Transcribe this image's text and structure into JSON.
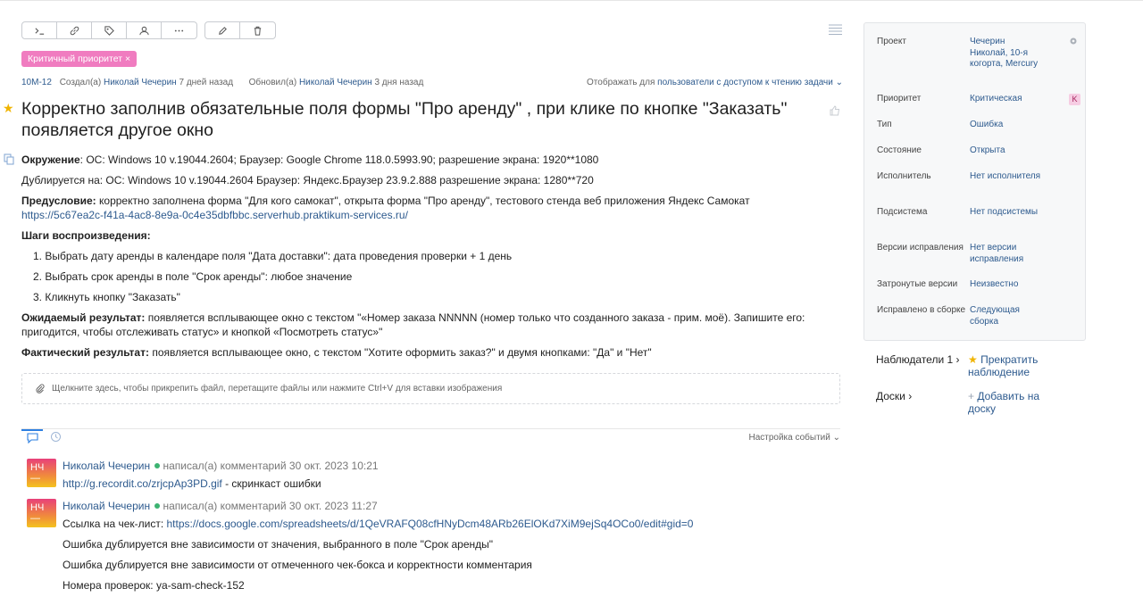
{
  "toolbar": {
    "buttons": [
      {
        "icon": "terminal-icon"
      },
      {
        "icon": "link-icon"
      },
      {
        "icon": "tag-icon"
      },
      {
        "icon": "user-icon"
      },
      {
        "icon": "more-icon"
      },
      {
        "icon": "edit-icon"
      },
      {
        "icon": "trash-icon"
      }
    ]
  },
  "issue": {
    "tag": "Критичный приоритет ×",
    "key": "10M-12",
    "created_prefix": "Создал(а)",
    "author": "Николай Чечерин",
    "created_ago": "7 дней назад",
    "updated_prefix": "Обновил(а)",
    "updater": "Николай Чечерин",
    "updated_ago": "3 дня назад",
    "visibility_prefix": "Отображать для",
    "visibility_link": "пользователи с доступом к чтению задачи",
    "title": "Корректно заполнив обязательные поля формы \"Про аренду\" , при клике по кнопке \"Заказать\" появляется другое окно"
  },
  "description": {
    "env_label": "Окружение",
    "env_text": ": ОС: Windows 10 v.19044.2604; Браузер: Google Chrome 118.0.5993.90; разрешение экрана: 1920**1080",
    "dup_text": "Дублируется на: ОС: Windows 10 v.19044.2604 Браузер: Яндекс.Браузер 23.9.2.888 разрешение экрана: 1280**720",
    "pre_label": "Предусловие:",
    "pre_text": " корректно заполнена форма \"Для кого самокат\", открыта форма \"Про аренду\", тестового стенда веб приложения Яндекс Самокат",
    "pre_link": "https://5c67ea2c-f41a-4ac8-8e9a-0c4e35dbfbbc.serverhub.praktikum-services.ru/",
    "steps_label": "Шаги воспроизведения:",
    "steps": [
      "1. Выбрать дату аренды в календаре поля \"Дата доставки\": дата проведения проверки + 1 день",
      "2. Выбрать срок аренды в поле \"Срок аренды\": любое значение",
      "3. Кликнуть кнопку \"Заказать\""
    ],
    "expected_label": "Ожидаемый результат:",
    "expected_text": " появляется всплывающее окно с текстом \"«Номер заказа NNNNN (номер только что созданного заказа - прим. моё). Запишите его: пригодится, чтобы отслеживать статус» и кнопкой «Посмотреть статус»\"",
    "actual_label": "Фактический результат:",
    "actual_text": " появляется всплывающее окно, с текстом \"Хотите оформить заказ?\" и двумя кнопками: \"Да\" и \"Нет\""
  },
  "attach": {
    "text": "Щелкните здесь, чтобы прикрепить файл, перетащите файлы или нажмите Ctrl+V для вставки изображения"
  },
  "activity": {
    "events_setting": "Настройка событий ⌄"
  },
  "comments": [
    {
      "avatar": "НЧ",
      "author": "Николай Чечерин",
      "action": "написал(а) комментарий 30 окт. 2023 10:21",
      "link": "http://g.recordit.co/zrjcpAp3PD.gif",
      "link_suffix": " - скринкаст ошибки"
    },
    {
      "avatar": "НЧ",
      "author": "Николай Чечерин",
      "action": "написал(а) комментарий 30 окт. 2023 11:27",
      "line1_prefix": "Ссылка на чек-лист: ",
      "line1_link": "https://docs.google.com/spreadsheets/d/1QeVRAFQ08cfHNyDcm48ARb26ElOKd7XiM9ejSq4OCo0/edit#gid=0",
      "line2": "Ошибка дублируется вне зависимости от значения, выбранного в поле \"Срок аренды\"",
      "line3": "Ошибка дублируется вне зависимости от отмеченного чек-бокса и корректности комментария",
      "line4": "Номера проверок: ya-sam-check-152"
    }
  ],
  "sidebar": {
    "project_label": "Проект",
    "project_value": "Чечерин Николай, 10-я когорта, Mercury",
    "priority_label": "Приоритет",
    "priority_value": "Критическая",
    "priority_badge": "K",
    "type_label": "Тип",
    "type_value": "Ошибка",
    "state_label": "Состояние",
    "state_value": "Открыта",
    "assignee_label": "Исполнитель",
    "assignee_value": "Нет исполнителя",
    "subsystem_label": "Подсистема",
    "subsystem_value": "Нет подсистемы",
    "fixver_label": "Версии исправления",
    "fixver_value": "Нет версии исправления",
    "affected_label": "Затронутые версии",
    "affected_value": "Неизвестно",
    "fixedin_label": "Исправлено в сборке",
    "fixedin_value": "Следующая сборка"
  },
  "watchers": {
    "label": "Наблюдатели 1 ›",
    "stop": "Прекратить наблюдение"
  },
  "boards": {
    "label": "Доски ›",
    "add": "Добавить на доску"
  },
  "colors": {
    "accent": "#2d5a8e",
    "tag": "#f07cc0",
    "star": "#f0b400",
    "online": "#3cb371"
  }
}
